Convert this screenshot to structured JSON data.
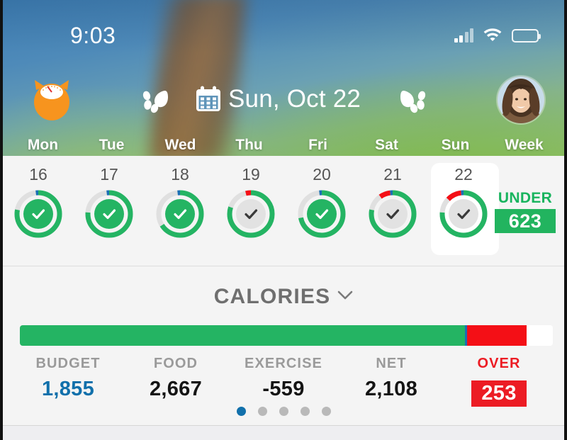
{
  "status_bar": {
    "time": "9:03",
    "signal_icon": "cellular-signal-icon",
    "wifi_icon": "wifi-icon",
    "battery_icon": "battery-icon"
  },
  "header": {
    "app_logo_icon": "loseit-cat-scale-logo-icon",
    "prev_day_icon": "paw-previous-icon",
    "next_day_icon": "paw-next-icon",
    "calendar_icon": "calendar-icon",
    "date": "Sun, Oct 22",
    "avatar_icon": "user-avatar"
  },
  "weekdays": [
    {
      "label": "Mon"
    },
    {
      "label": "Tue"
    },
    {
      "label": "Wed"
    },
    {
      "label": "Thu"
    },
    {
      "label": "Fri"
    },
    {
      "label": "Sat"
    },
    {
      "label": "Sun"
    },
    {
      "label": "Week"
    }
  ],
  "days": [
    {
      "date": "16",
      "status": "done",
      "green_pct": 78,
      "red_pct": 0,
      "blue_pct": 2,
      "selected": false
    },
    {
      "date": "17",
      "status": "done",
      "green_pct": 76,
      "red_pct": 0,
      "blue_pct": 2,
      "selected": false
    },
    {
      "date": "18",
      "status": "done",
      "green_pct": 66,
      "red_pct": 0,
      "blue_pct": 2,
      "selected": false
    },
    {
      "date": "19",
      "status": "not-done",
      "green_pct": 80,
      "red_pct": 4,
      "blue_pct": 0,
      "selected": false
    },
    {
      "date": "20",
      "status": "done",
      "green_pct": 72,
      "red_pct": 0,
      "blue_pct": 2,
      "selected": false
    },
    {
      "date": "21",
      "status": "not-done",
      "green_pct": 78,
      "red_pct": 8,
      "blue_pct": 2,
      "selected": false
    },
    {
      "date": "22",
      "status": "not-done",
      "green_pct": 76,
      "red_pct": 11,
      "blue_pct": 2,
      "selected": true
    }
  ],
  "under_badge": {
    "label": "UNDER",
    "value": "623"
  },
  "calories_panel": {
    "title": "CALORIES",
    "expand_icon": "chevron-down-icon",
    "progress": {
      "green_pct": 83.5,
      "divider_pct": 0.4,
      "red_pct": 11.2,
      "remaining_pct": 4.9
    },
    "stats": [
      {
        "label": "BUDGET",
        "value": "1,855",
        "value_style": "budget"
      },
      {
        "label": "FOOD",
        "value": "2,667",
        "value_style": "plain"
      },
      {
        "label": "EXERCISE",
        "value": "-559",
        "value_style": "plain"
      },
      {
        "label": "NET",
        "value": "2,108",
        "value_style": "plain"
      },
      {
        "label": "OVER",
        "value": "253",
        "value_style": "over"
      }
    ],
    "page_dots": {
      "count": 5,
      "active_index": 0
    }
  },
  "colors": {
    "green": "#24b463",
    "red": "#ec1c24",
    "bar_red": "#f40f16",
    "blue": "#1170ab",
    "bar_divider_blue": "#1a6fb5",
    "gray_track": "#e0e0e0",
    "label_gray": "#9a9a9a",
    "panel_bg": "#f4f4f4"
  }
}
